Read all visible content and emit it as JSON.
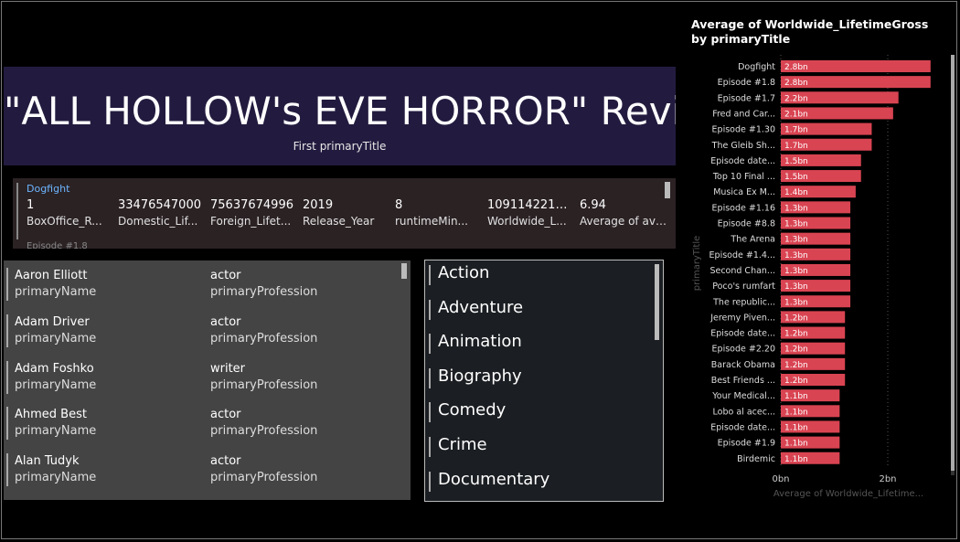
{
  "title_card": {
    "value": "\"ALL HOLLOW's EVE HORROR\" Revi...",
    "label": "First primaryTitle"
  },
  "multirow": {
    "row_title": "Dogfight",
    "cells": [
      {
        "value": "1",
        "label": "BoxOffice_R..."
      },
      {
        "value": "33476547000",
        "label": "Domestic_Lif..."
      },
      {
        "value": "75637674996",
        "label": "Foreign_Lifet..."
      },
      {
        "value": "2019",
        "label": "Release_Year"
      },
      {
        "value": "8",
        "label": "runtimeMin..."
      },
      {
        "value": "1091142219...",
        "label": "Worldwide_L..."
      },
      {
        "value": "6.94",
        "label": "Average of aver..."
      }
    ],
    "next_row": "Episode #1.8"
  },
  "people": [
    {
      "name": "Aaron Elliott",
      "name_label": "primaryName",
      "profession": "actor",
      "profession_label": "primaryProfession"
    },
    {
      "name": "Adam Driver",
      "name_label": "primaryName",
      "profession": "actor",
      "profession_label": "primaryProfession"
    },
    {
      "name": "Adam Foshko",
      "name_label": "primaryName",
      "profession": "writer",
      "profession_label": "primaryProfession"
    },
    {
      "name": "Ahmed Best",
      "name_label": "primaryName",
      "profession": "actor",
      "profession_label": "primaryProfession"
    },
    {
      "name": "Alan Tudyk",
      "name_label": "primaryName",
      "profession": "actor",
      "profession_label": "primaryProfession"
    }
  ],
  "genres": [
    "Action",
    "Adventure",
    "Animation",
    "Biography",
    "Comedy",
    "Crime",
    "Documentary"
  ],
  "colors": {
    "bar": "#d94452",
    "title_bg": "#231b3f",
    "card_bg": "#444444"
  },
  "chart_data": {
    "type": "bar",
    "orientation": "horizontal",
    "title": "Average of Worldwide_LifetimeGross by primaryTitle",
    "xlabel": "Average of Worldwide_Lifetime...",
    "ylabel": "primaryTitle",
    "x_ticks": [
      "0bn",
      "2bn"
    ],
    "xlim": [
      0,
      2.9
    ],
    "categories": [
      "Dogfight",
      "Episode #1.8",
      "Episode #1.7",
      "Fred and Car...",
      "Episode #1.30",
      "The Gleib Sh...",
      "Episode date...",
      "Top 10 Final ...",
      "Musica Ex M...",
      "Episode #1.16",
      "Episode #8.8",
      "The Arena",
      "Episode #1.4...",
      "Second Chan...",
      "Poco's rumfart",
      "The republic...",
      "Jeremy Piven...",
      "Episode date...",
      "Episode #2.20",
      "Barack Obama",
      "Best Friends ...",
      "Your Medical...",
      "Lobo al acec...",
      "Episode date...",
      "Episode #1.9",
      "Birdemic"
    ],
    "values": [
      2.8,
      2.8,
      2.2,
      2.1,
      1.7,
      1.7,
      1.5,
      1.5,
      1.4,
      1.3,
      1.3,
      1.3,
      1.3,
      1.3,
      1.3,
      1.3,
      1.2,
      1.2,
      1.2,
      1.2,
      1.2,
      1.1,
      1.1,
      1.1,
      1.1,
      1.1
    ],
    "data_labels": [
      "2.8bn",
      "2.8bn",
      "2.2bn",
      "2.1bn",
      "1.7bn",
      "1.7bn",
      "1.5bn",
      "1.5bn",
      "1.4bn",
      "1.3bn",
      "1.3bn",
      "1.3bn",
      "1.3bn",
      "1.3bn",
      "1.3bn",
      "1.3bn",
      "1.2bn",
      "1.2bn",
      "1.2bn",
      "1.2bn",
      "1.2bn",
      "1.1bn",
      "1.1bn",
      "1.1bn",
      "1.1bn",
      "1.1bn"
    ],
    "grid": true
  }
}
